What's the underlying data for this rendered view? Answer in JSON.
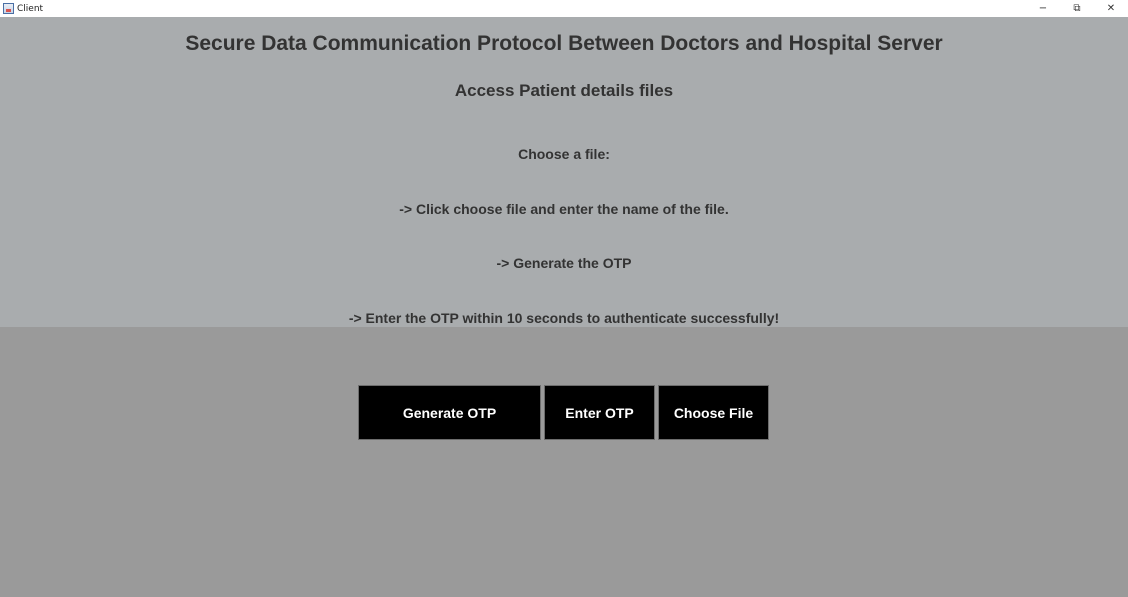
{
  "window": {
    "title": "Client",
    "minimize_glyph": "−",
    "restore_glyph": "⧉",
    "close_glyph": "✕"
  },
  "main": {
    "heading": "Secure Data Communication Protocol Between Doctors and Hospital Server",
    "subheading": "Access Patient details files",
    "instructions": [
      "Choose a file:",
      "-> Click choose file and enter the name of the file.",
      "-> Generate the OTP",
      "-> Enter the OTP within 10 seconds to authenticate successfully!"
    ]
  },
  "buttons": {
    "generate_otp": "Generate OTP",
    "enter_otp": "Enter OTP",
    "choose_file": "Choose File"
  },
  "colors": {
    "top_panel": "#a9acae",
    "bottom_panel": "#9a9a9a",
    "text": "#333333",
    "button_bg": "#000000",
    "button_text": "#ffffff"
  },
  "icons": {
    "app": "java-app-icon",
    "minimize": "minimize-icon",
    "restore": "restore-icon",
    "close": "close-icon"
  }
}
